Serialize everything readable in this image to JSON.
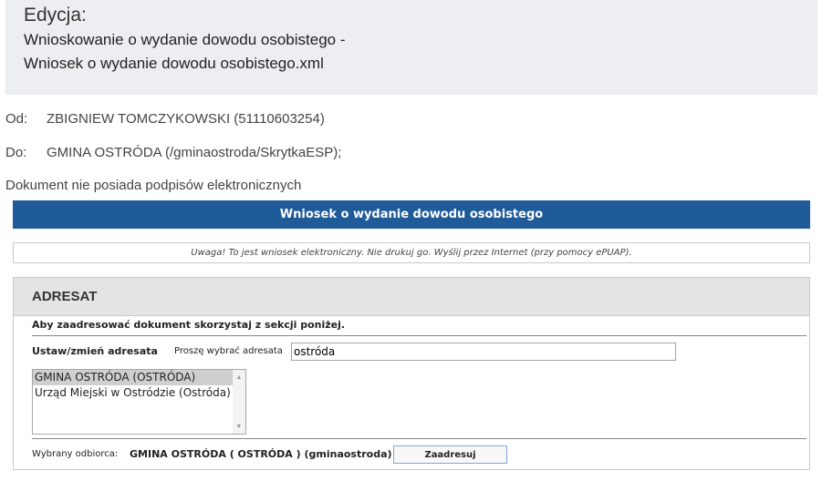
{
  "header": {
    "title": "Edycja:",
    "document_line1": "Wnioskowanie o wydanie dowodu osobistego -",
    "document_line2": "Wniosek o wydanie dowodu osobistego.xml"
  },
  "meta": {
    "from_label": "Od:",
    "from_value": "ZBIGNIEW TOMCZYKOWSKI (51110603254)",
    "to_label": "Do:",
    "to_value": "GMINA OSTRÓDA (/gminaostroda/SkrytkaESP);",
    "signature_status": "Dokument nie posiada podpisów elektronicznych"
  },
  "form": {
    "title": "Wniosek o wydanie dowodu osobistego",
    "warning": "Uwaga! To jest wniosek elektroniczny. Nie drukuj go. Wyślij przez Internet (przy pomocy ePUAP).",
    "colors": {
      "title_bar": "#1f5a99",
      "section_header": "#e4e4e4"
    }
  },
  "adresat": {
    "section_title": "ADRESAT",
    "hint": "Aby zaadresować dokument skorzystaj z sekcji poniżej.",
    "set_label": "Ustaw/zmień adresata",
    "choose_label": "Proszę wybrać adresata",
    "search_value": "ostróda",
    "options": [
      {
        "label": "GMINA OSTRÓDA (OSTRÓDA)",
        "selected": true
      },
      {
        "label": "Urząd Miejski w Ostródzie (Ostróda)",
        "selected": false
      }
    ],
    "selected_recipient_label": "Wybrany odbiorca:",
    "selected_recipient_value": "GMINA OSTRÓDA ( OSTRÓDA ) (gminaostroda)",
    "address_button": "Zaadresuj"
  },
  "icons": {
    "scroll_up": "scroll-up-icon",
    "scroll_down": "scroll-down-icon"
  }
}
